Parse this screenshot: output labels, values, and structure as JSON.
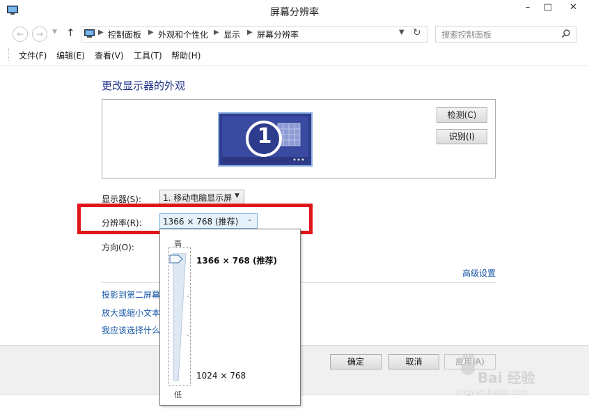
{
  "window": {
    "title": "屏幕分辨率",
    "minimize": "–",
    "maximize": "□",
    "close": "✕"
  },
  "nav": {
    "back_icon": "back-arrow-icon",
    "forward_icon": "forward-arrow-icon",
    "up_icon": "up-arrow-icon",
    "breadcrumbs": [
      "控制面板",
      "外观和个性化",
      "显示",
      "屏幕分辨率"
    ],
    "search_placeholder": "搜索控制面板"
  },
  "menu": [
    "文件(F)",
    "编辑(E)",
    "查看(V)",
    "工具(T)",
    "帮助(H)"
  ],
  "main": {
    "heading": "更改显示器的外观",
    "monitor_number": "1",
    "detect_label": "检测(C)",
    "identify_label": "识别(I)",
    "display_label": "显示器(S):",
    "display_value": "1. 移动电脑显示屏",
    "resolution_label": "分辨率(R):",
    "resolution_value": "1366 × 768 (推荐)",
    "orientation_label": "方向(O):",
    "advanced_link": "高级设置",
    "links": [
      "投影到第二屏幕",
      "放大或缩小文本",
      "我应该选择什么"
    ]
  },
  "popup": {
    "high": "高",
    "low": "低",
    "res_high": "1366 × 768 (推荐)",
    "res_low": "1024 × 768",
    "slider_level": 1.0
  },
  "footer": {
    "ok": "确定",
    "cancel": "取消",
    "apply": "应用(A)"
  },
  "watermark": {
    "text": "Bai 经验",
    "url": "jingyan.baidu.com"
  },
  "colors": {
    "heading": "#1e3287",
    "link": "#1a5aa8",
    "highlight_box": "#e0141a",
    "monitor_screen": "#3a4aa0"
  }
}
